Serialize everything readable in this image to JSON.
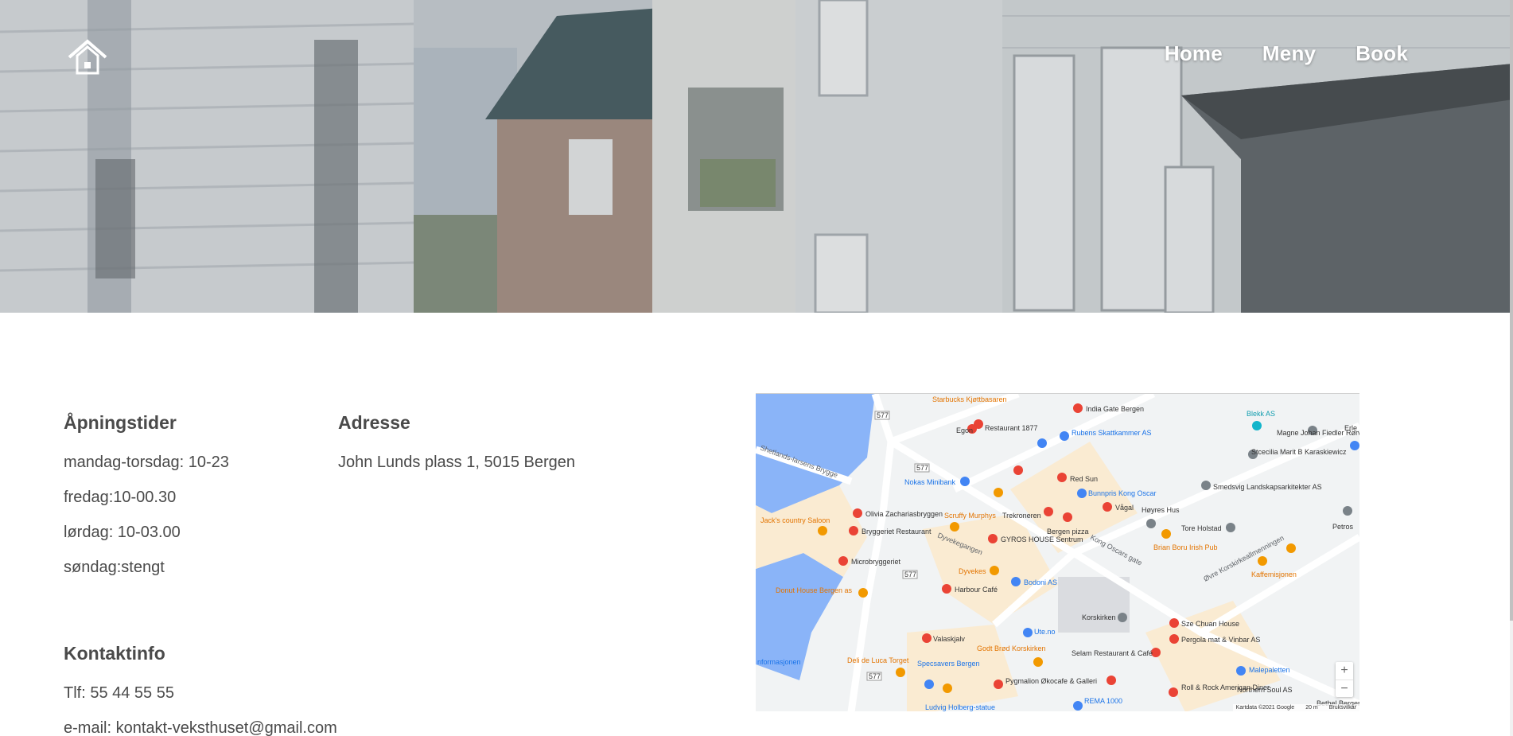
{
  "nav": {
    "items": [
      "Home",
      "Meny",
      "Book"
    ]
  },
  "hours": {
    "title": "Åpningstider",
    "lines": [
      "mandag-torsdag: 10-23",
      "fredag:10-00.30",
      "lørdag: 10-03.00",
      "søndag:stengt"
    ]
  },
  "address": {
    "title": "Adresse",
    "line": "John Lunds plass 1, 5015 Bergen"
  },
  "contact": {
    "title": "Kontaktinfo",
    "phone": "Tlf: 55 44 55 55",
    "email": "e-mail: kontakt-veksthuset@gmail.com"
  },
  "map": {
    "labels": {
      "starbucks": "Starbucks Kjøttbasaren",
      "india_gate": "India Gate Bergen",
      "restaurant_1877": "Restaurant 1877",
      "egon": "Egon",
      "rubens": "Rubens Skattkammer AS",
      "blekk": "Blekk AS",
      "nokas": "Nokas Minibank",
      "red_sun": "Red Sun",
      "bunnpris": "Bunnpris Kong Oscar",
      "scruffy": "Scruffy Murphys",
      "olivia": "Olivia Zachariasbryggen",
      "jacks": "Jack's country Saloon",
      "bryggeriet": "Bryggeriet Restaurant",
      "trekroneren": "Trekroneren",
      "vagal": "Vågal",
      "bergen_pizza": "Bergen pizza",
      "gyros": "GYROS HOUSE Sentrum",
      "microbryggeriet": "Microbryggeriet",
      "dyvekes": "Dyvekes",
      "donut": "Donut House Bergen as",
      "harbour": "Harbour Café",
      "bodoni": "Bodoni AS",
      "korskirken": "Korskirken",
      "tore_holstad": "Tore Holstad",
      "brian_boru": "Brian Boru Irish Pub",
      "kaffemisjonen": "Kaffemisjonen",
      "sze_chuan": "Sze Chuan House",
      "pergola": "Pergola mat & Vinbar AS",
      "selam": "Selam Restaurant & Café",
      "valaskjalv": "Valaskjalv",
      "godt_brod": "Godt Brød Korskirken",
      "deli": "Deli de Luca Torget",
      "specsavers": "Specsavers Bergen",
      "pygmalion": "Pygmalion Økocafe & Galleri",
      "malepaletten": "Malepaletten",
      "roll_rock": "Roll & Rock American Diner",
      "ute": "Ute.no",
      "rema": "REMA 1000",
      "ludvig": "Ludvig Holberg-statue",
      "stcecilia": "Stcecilia Marit B Karaskiewicz",
      "magne": "Magne Johan Fiedler Rørvik",
      "smedsvig": "Smedsvig Landskapsarkitekter AS",
      "hoyres": "Høyres Hus",
      "northern_soul": "Northern Soul AS",
      "road_577": "577",
      "shetlands": "Shetlands-larsens Brygge",
      "kong_oscars": "Kong Oscars gate",
      "dyvekegangen": "Dyvekegangen",
      "ovre_kors": "Øvre Korskirkeallmenningen",
      "informasjonen": "nformasjonen",
      "petros": "Petros",
      "bethel": "Bethel Bergen",
      "erle": "Erle"
    },
    "footer": {
      "copyright": "Kartdata ©2021 Google",
      "scale": "20 m",
      "terms": "Bruksvilkår"
    },
    "zoom_in": "+",
    "zoom_out": "−"
  },
  "colors": {
    "accent_text": "#4a4a4a",
    "map_water": "#8ab4f8",
    "map_restaurant_pin": "#ea4335",
    "map_cafe_pin": "#f29900",
    "map_shop_pin": "#4285f4"
  }
}
